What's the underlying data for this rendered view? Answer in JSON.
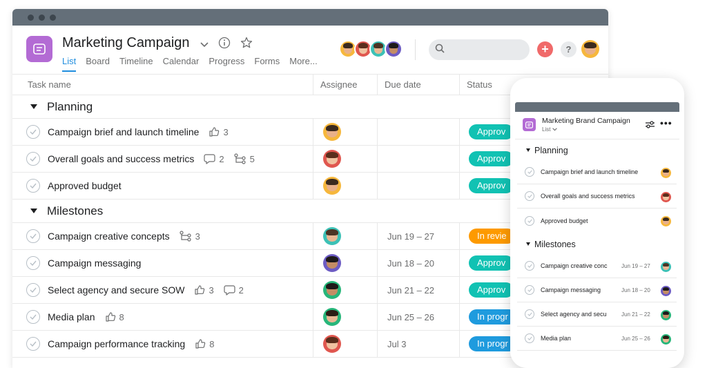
{
  "window": {
    "dots": [
      "close",
      "minimize",
      "maximize"
    ]
  },
  "project": {
    "title": "Marketing Campaign",
    "icon": "list-icon",
    "color": "#b36bd4",
    "tabs": [
      {
        "label": "List",
        "active": true
      },
      {
        "label": "Board",
        "active": false
      },
      {
        "label": "Timeline",
        "active": false
      },
      {
        "label": "Calendar",
        "active": false
      },
      {
        "label": "Progress",
        "active": false
      },
      {
        "label": "Forms",
        "active": false
      },
      {
        "label": "More...",
        "active": false
      }
    ]
  },
  "colors": {
    "accent": "#1f8dde",
    "approved": "#11c2b3",
    "in_review": "#fd9a00",
    "in_progress": "#1f9bde",
    "add_button": "#f06a6a"
  },
  "table": {
    "columns": [
      "Task name",
      "Assignee",
      "Due date",
      "Status"
    ],
    "sections": [
      {
        "name": "Planning",
        "tasks": [
          {
            "name": "Campaign brief and launch timeline",
            "likes": "3",
            "comments": "",
            "subtasks": "",
            "due": "",
            "status": "Approv"
          },
          {
            "name": "Overall goals and success metrics",
            "likes": "",
            "comments": "2",
            "subtasks": "5",
            "due": "",
            "status": "Approv"
          },
          {
            "name": "Approved budget",
            "likes": "",
            "comments": "",
            "subtasks": "",
            "due": "",
            "status": "Approv"
          }
        ]
      },
      {
        "name": "Milestones",
        "tasks": [
          {
            "name": "Campaign creative concepts",
            "likes": "",
            "comments": "",
            "subtasks": "3",
            "due": "Jun 19 – 27",
            "status": "In revie"
          },
          {
            "name": "Campaign messaging",
            "likes": "",
            "comments": "",
            "subtasks": "",
            "due": "Jun 18 – 20",
            "status": "Approv"
          },
          {
            "name": "Select agency and secure SOW",
            "likes": "3",
            "comments": "2",
            "subtasks": "",
            "due": "Jun 21 – 22",
            "status": "Approv"
          },
          {
            "name": "Media plan",
            "likes": "8",
            "comments": "",
            "subtasks": "",
            "due": "Jun 25 – 26",
            "status": "In progr"
          },
          {
            "name": "Campaign performance tracking",
            "likes": "8",
            "comments": "",
            "subtasks": "",
            "due": "Jul 3",
            "status": "In progr"
          }
        ]
      }
    ]
  },
  "mobile": {
    "title": "Marketing Brand Campaign",
    "view": "List",
    "sections": [
      {
        "name": "Planning",
        "tasks": [
          {
            "name": "Campaign brief and launch timeline",
            "due": ""
          },
          {
            "name": "Overall goals and success metrics",
            "due": ""
          },
          {
            "name": "Approved budget",
            "due": ""
          }
        ]
      },
      {
        "name": "Milestones",
        "tasks": [
          {
            "name": "Campaign creative conc",
            "due": "Jun 19 – 27"
          },
          {
            "name": "Campaign messaging",
            "due": "Jun 18 – 20"
          },
          {
            "name": "Select agency and secu",
            "due": "Jun 21 – 22"
          },
          {
            "name": "Media plan",
            "due": "Jun 25 – 26"
          }
        ]
      }
    ]
  }
}
